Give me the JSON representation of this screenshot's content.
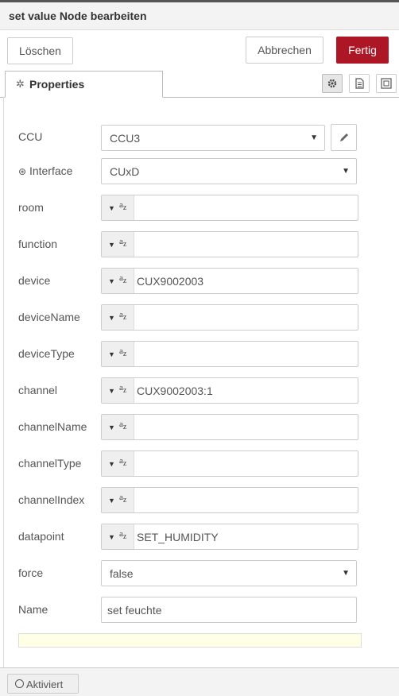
{
  "dialog": {
    "title": "set value Node bearbeiten",
    "delete_label": "Löschen",
    "cancel_label": "Abbrechen",
    "done_label": "Fertig"
  },
  "tabs": {
    "properties_label": "Properties"
  },
  "form": {
    "ccu": {
      "label": "CCU",
      "value": "CCU3"
    },
    "interface": {
      "label": "Interface",
      "value": "CUxD"
    },
    "room": {
      "label": "room",
      "value": ""
    },
    "function": {
      "label": "function",
      "value": ""
    },
    "device": {
      "label": "device",
      "value": "CUX9002003"
    },
    "deviceName": {
      "label": "deviceName",
      "value": ""
    },
    "deviceType": {
      "label": "deviceType",
      "value": ""
    },
    "channel": {
      "label": "channel",
      "value": "CUX9002003:1"
    },
    "channelName": {
      "label": "channelName",
      "value": ""
    },
    "channelType": {
      "label": "channelType",
      "value": ""
    },
    "channelIndex": {
      "label": "channelIndex",
      "value": ""
    },
    "datapoint": {
      "label": "datapoint",
      "value": "SET_HUMIDITY"
    },
    "force": {
      "label": "force",
      "value": "false"
    },
    "name": {
      "label": "Name",
      "value": "set feuchte"
    },
    "typed_prefix_a": "a",
    "typed_prefix_z": "z"
  },
  "footer": {
    "status_label": "Aktiviert"
  },
  "colors": {
    "primary": "#ad1625",
    "note_bg": "#ffffe6"
  }
}
